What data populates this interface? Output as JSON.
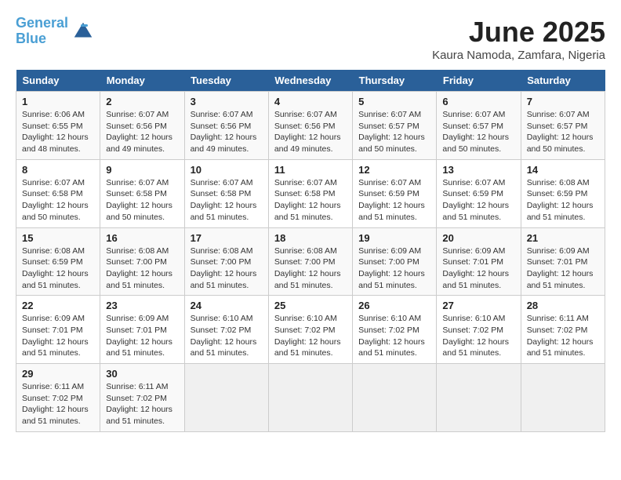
{
  "header": {
    "logo_line1": "General",
    "logo_line2": "Blue",
    "month": "June 2025",
    "location": "Kaura Namoda, Zamfara, Nigeria"
  },
  "weekdays": [
    "Sunday",
    "Monday",
    "Tuesday",
    "Wednesday",
    "Thursday",
    "Friday",
    "Saturday"
  ],
  "weeks": [
    [
      {
        "day": "1",
        "info": "Sunrise: 6:06 AM\nSunset: 6:55 PM\nDaylight: 12 hours\nand 48 minutes."
      },
      {
        "day": "2",
        "info": "Sunrise: 6:07 AM\nSunset: 6:56 PM\nDaylight: 12 hours\nand 49 minutes."
      },
      {
        "day": "3",
        "info": "Sunrise: 6:07 AM\nSunset: 6:56 PM\nDaylight: 12 hours\nand 49 minutes."
      },
      {
        "day": "4",
        "info": "Sunrise: 6:07 AM\nSunset: 6:56 PM\nDaylight: 12 hours\nand 49 minutes."
      },
      {
        "day": "5",
        "info": "Sunrise: 6:07 AM\nSunset: 6:57 PM\nDaylight: 12 hours\nand 50 minutes."
      },
      {
        "day": "6",
        "info": "Sunrise: 6:07 AM\nSunset: 6:57 PM\nDaylight: 12 hours\nand 50 minutes."
      },
      {
        "day": "7",
        "info": "Sunrise: 6:07 AM\nSunset: 6:57 PM\nDaylight: 12 hours\nand 50 minutes."
      }
    ],
    [
      {
        "day": "8",
        "info": "Sunrise: 6:07 AM\nSunset: 6:58 PM\nDaylight: 12 hours\nand 50 minutes."
      },
      {
        "day": "9",
        "info": "Sunrise: 6:07 AM\nSunset: 6:58 PM\nDaylight: 12 hours\nand 50 minutes."
      },
      {
        "day": "10",
        "info": "Sunrise: 6:07 AM\nSunset: 6:58 PM\nDaylight: 12 hours\nand 51 minutes."
      },
      {
        "day": "11",
        "info": "Sunrise: 6:07 AM\nSunset: 6:58 PM\nDaylight: 12 hours\nand 51 minutes."
      },
      {
        "day": "12",
        "info": "Sunrise: 6:07 AM\nSunset: 6:59 PM\nDaylight: 12 hours\nand 51 minutes."
      },
      {
        "day": "13",
        "info": "Sunrise: 6:07 AM\nSunset: 6:59 PM\nDaylight: 12 hours\nand 51 minutes."
      },
      {
        "day": "14",
        "info": "Sunrise: 6:08 AM\nSunset: 6:59 PM\nDaylight: 12 hours\nand 51 minutes."
      }
    ],
    [
      {
        "day": "15",
        "info": "Sunrise: 6:08 AM\nSunset: 6:59 PM\nDaylight: 12 hours\nand 51 minutes."
      },
      {
        "day": "16",
        "info": "Sunrise: 6:08 AM\nSunset: 7:00 PM\nDaylight: 12 hours\nand 51 minutes."
      },
      {
        "day": "17",
        "info": "Sunrise: 6:08 AM\nSunset: 7:00 PM\nDaylight: 12 hours\nand 51 minutes."
      },
      {
        "day": "18",
        "info": "Sunrise: 6:08 AM\nSunset: 7:00 PM\nDaylight: 12 hours\nand 51 minutes."
      },
      {
        "day": "19",
        "info": "Sunrise: 6:09 AM\nSunset: 7:00 PM\nDaylight: 12 hours\nand 51 minutes."
      },
      {
        "day": "20",
        "info": "Sunrise: 6:09 AM\nSunset: 7:01 PM\nDaylight: 12 hours\nand 51 minutes."
      },
      {
        "day": "21",
        "info": "Sunrise: 6:09 AM\nSunset: 7:01 PM\nDaylight: 12 hours\nand 51 minutes."
      }
    ],
    [
      {
        "day": "22",
        "info": "Sunrise: 6:09 AM\nSunset: 7:01 PM\nDaylight: 12 hours\nand 51 minutes."
      },
      {
        "day": "23",
        "info": "Sunrise: 6:09 AM\nSunset: 7:01 PM\nDaylight: 12 hours\nand 51 minutes."
      },
      {
        "day": "24",
        "info": "Sunrise: 6:10 AM\nSunset: 7:02 PM\nDaylight: 12 hours\nand 51 minutes."
      },
      {
        "day": "25",
        "info": "Sunrise: 6:10 AM\nSunset: 7:02 PM\nDaylight: 12 hours\nand 51 minutes."
      },
      {
        "day": "26",
        "info": "Sunrise: 6:10 AM\nSunset: 7:02 PM\nDaylight: 12 hours\nand 51 minutes."
      },
      {
        "day": "27",
        "info": "Sunrise: 6:10 AM\nSunset: 7:02 PM\nDaylight: 12 hours\nand 51 minutes."
      },
      {
        "day": "28",
        "info": "Sunrise: 6:11 AM\nSunset: 7:02 PM\nDaylight: 12 hours\nand 51 minutes."
      }
    ],
    [
      {
        "day": "29",
        "info": "Sunrise: 6:11 AM\nSunset: 7:02 PM\nDaylight: 12 hours\nand 51 minutes."
      },
      {
        "day": "30",
        "info": "Sunrise: 6:11 AM\nSunset: 7:02 PM\nDaylight: 12 hours\nand 51 minutes."
      },
      {
        "day": "",
        "info": ""
      },
      {
        "day": "",
        "info": ""
      },
      {
        "day": "",
        "info": ""
      },
      {
        "day": "",
        "info": ""
      },
      {
        "day": "",
        "info": ""
      }
    ]
  ]
}
